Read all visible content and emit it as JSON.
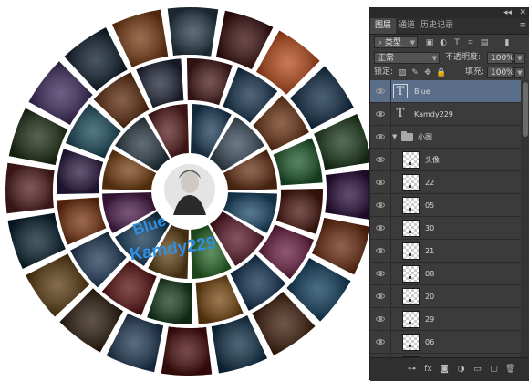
{
  "artwork": {
    "text_line1": "Blue",
    "text_line2": "Kamdy229",
    "accent_text": "#2f8fe0",
    "segments": {
      "ring3": [
        "#3a0d0d",
        "#b84a1a",
        "#0d2a44",
        "#1c3a1c",
        "#2b0f3d",
        "#6a2a10",
        "#0e3b5a",
        "#3e1c0a",
        "#12324a",
        "#4a0e0e",
        "#203a55",
        "#2a1a0a",
        "#5a3a10",
        "#0a2230",
        "#552020",
        "#1e2f14",
        "#3c2a5c",
        "#0b1b2b",
        "#7a3b14",
        "#283c4a"
      ],
      "ring2": [
        "#16324e",
        "#6b3213",
        "#1f5a2c",
        "#4b1810",
        "#6a1e40",
        "#0f2f4f",
        "#7a4a14",
        "#1a3f1f",
        "#5a1010",
        "#203a58",
        "#7b3512",
        "#2c1d44",
        "#1a4a5a",
        "#5c2a0c",
        "#22283a",
        "#4a1c1c"
      ],
      "ring1": [
        "#3b4d5c",
        "#6a3518",
        "#1d4a6a",
        "#5a1a2a",
        "#2c6a2c",
        "#64451a",
        "#163a56",
        "#4d1d4d",
        "#7a4214",
        "#2a3a44",
        "#5a2020",
        "#1e3e5a"
      ]
    }
  },
  "panel": {
    "tabs": [
      "图层",
      "通道",
      "历史记录"
    ],
    "active_tab": 0,
    "filter_label": "类型",
    "blend_mode": "正常",
    "opacity_label": "不透明度:",
    "opacity_value": "100%",
    "lock_label": "锁定:",
    "fill_label": "填充:",
    "fill_value": "100%",
    "layers": [
      {
        "kind": "text",
        "name": "Blue",
        "selected": true
      },
      {
        "kind": "text",
        "name": "Kamdy229",
        "selected": false
      },
      {
        "kind": "group",
        "name": "小图",
        "selected": false
      },
      {
        "kind": "image",
        "name": "头像",
        "selected": false
      },
      {
        "kind": "image",
        "name": "22",
        "selected": false
      },
      {
        "kind": "image",
        "name": "05",
        "selected": false
      },
      {
        "kind": "image",
        "name": "30",
        "selected": false
      },
      {
        "kind": "image",
        "name": "21",
        "selected": false
      },
      {
        "kind": "image",
        "name": "08",
        "selected": false
      },
      {
        "kind": "image",
        "name": "20",
        "selected": false
      },
      {
        "kind": "image",
        "name": "29",
        "selected": false
      },
      {
        "kind": "image",
        "name": "06",
        "selected": false
      },
      {
        "kind": "image",
        "name": "",
        "selected": false
      }
    ],
    "icons": {
      "top": [
        "collapse-arrows-icon",
        "close-icon"
      ],
      "filter": [
        "pixel-filter-icon",
        "adjustment-filter-icon",
        "type-filter-icon",
        "shape-filter-icon",
        "smart-object-filter-icon",
        "filter-toggle-icon"
      ],
      "lock": [
        "lock-transparent-icon",
        "lock-image-icon",
        "lock-position-icon",
        "lock-all-icon"
      ],
      "footer": [
        "link-layers-icon",
        "fx-icon",
        "add-mask-icon",
        "adjustment-layer-icon",
        "new-group-icon",
        "new-layer-icon",
        "delete-layer-icon"
      ]
    }
  }
}
